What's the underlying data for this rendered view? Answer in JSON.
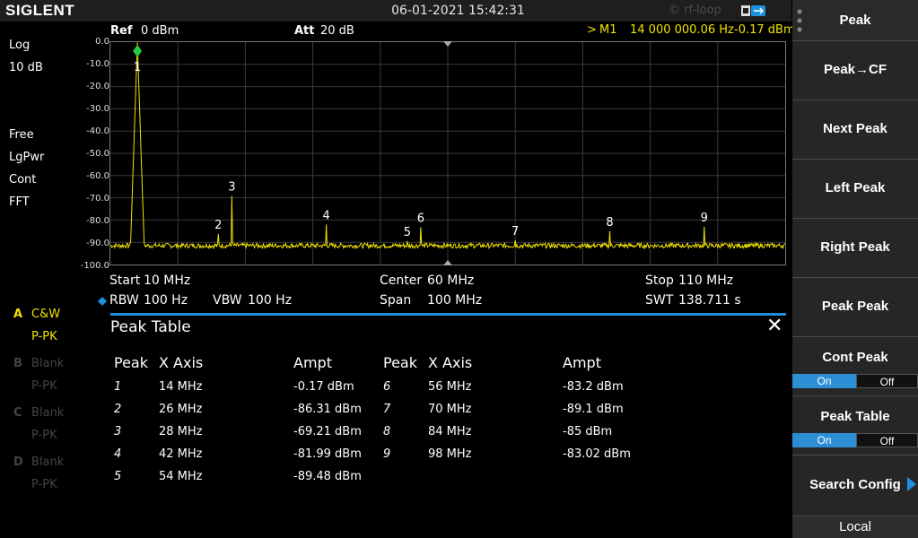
{
  "header": {
    "brand": "SIGLENT",
    "datetime": "06-01-2021 15:42:31",
    "watermark": "© rf-loop"
  },
  "info_line": {
    "ref_label": "Ref",
    "ref_value": "0 dBm",
    "att_label": "Att",
    "att_value": "20 dB",
    "marker_prefix": ">",
    "marker_name": "M1",
    "marker_freq": "14 000 000.06 Hz",
    "marker_ampt": "-0.17 dBm"
  },
  "left_panel": {
    "scale_type": "Log",
    "scale_div": "10 dB",
    "trigger": "Free",
    "detector": "LgPwr",
    "sweep_mode": "Cont",
    "sweep_type": "FFT",
    "traces": [
      {
        "letter": "A",
        "mode": "C&W",
        "det": "P-PK"
      },
      {
        "letter": "B",
        "mode": "Blank",
        "det": "P-PK"
      },
      {
        "letter": "C",
        "mode": "Blank",
        "det": "P-PK"
      },
      {
        "letter": "D",
        "mode": "Blank",
        "det": "P-PK"
      }
    ]
  },
  "y_axis": {
    "labels": [
      "0.0",
      "-10.0",
      "-20.0",
      "-30.0",
      "-40.0",
      "-50.0",
      "-60.0",
      "-70.0",
      "-80.0",
      "-90.0",
      "-100.0"
    ]
  },
  "bottom_info": {
    "start_label": "Start",
    "start_value": "10 MHz",
    "center_label": "Center",
    "center_value": "60 MHz",
    "stop_label": "Stop",
    "stop_value": "110 MHz",
    "rbw_label": "RBW",
    "rbw_value": "100 Hz",
    "vbw_label": "VBW",
    "vbw_value": "100 Hz",
    "span_label": "Span",
    "span_value": "100 MHz",
    "swt_label": "SWT",
    "swt_value": "138.711 s"
  },
  "peak_table": {
    "title": "Peak Table",
    "headers": [
      "Peak",
      "X Axis",
      "Ampt"
    ],
    "rows": [
      {
        "n": "1",
        "x": "14 MHz",
        "a": "-0.17 dBm"
      },
      {
        "n": "2",
        "x": "26 MHz",
        "a": "-86.31 dBm"
      },
      {
        "n": "3",
        "x": "28 MHz",
        "a": "-69.21 dBm"
      },
      {
        "n": "4",
        "x": "42 MHz",
        "a": "-81.99 dBm"
      },
      {
        "n": "5",
        "x": "54 MHz",
        "a": "-89.48 dBm"
      },
      {
        "n": "6",
        "x": "56 MHz",
        "a": "-83.2 dBm"
      },
      {
        "n": "7",
        "x": "70 MHz",
        "a": "-89.1 dBm"
      },
      {
        "n": "8",
        "x": "84 MHz",
        "a": "-85 dBm"
      },
      {
        "n": "9",
        "x": "98 MHz",
        "a": "-83.02 dBm"
      }
    ]
  },
  "softkeys": {
    "title": "Peak",
    "peak_to_cf": "Peak→CF",
    "next_peak": "Next Peak",
    "left_peak": "Left Peak",
    "right_peak": "Right Peak",
    "peak_peak": "Peak Peak",
    "cont_peak": "Cont Peak",
    "peak_table": "Peak Table",
    "search_config": "Search Config",
    "on": "On",
    "off": "Off",
    "local": "Local"
  },
  "spectrum": {
    "x_range_mhz": [
      10,
      110
    ],
    "y_range_dbm": [
      -100,
      0
    ],
    "noise_floor_dbm": -91.5,
    "peaks": [
      {
        "label": "1",
        "freq_mhz": 14,
        "ampt_dbm": -0.17
      },
      {
        "label": "2",
        "freq_mhz": 26,
        "ampt_dbm": -86.31
      },
      {
        "label": "3",
        "freq_mhz": 28,
        "ampt_dbm": -69.21
      },
      {
        "label": "4",
        "freq_mhz": 42,
        "ampt_dbm": -81.99
      },
      {
        "label": "5",
        "freq_mhz": 54,
        "ampt_dbm": -89.48
      },
      {
        "label": "6",
        "freq_mhz": 56,
        "ampt_dbm": -83.2
      },
      {
        "label": "7",
        "freq_mhz": 70,
        "ampt_dbm": -89.1
      },
      {
        "label": "8",
        "freq_mhz": 84,
        "ampt_dbm": -85
      },
      {
        "label": "9",
        "freq_mhz": 98,
        "ampt_dbm": -83.02
      }
    ],
    "trace_color": "#f2e300",
    "marker_color": "#22cc44"
  },
  "colors": {
    "accent": "#1e90e0",
    "trace": "#f2e300"
  }
}
